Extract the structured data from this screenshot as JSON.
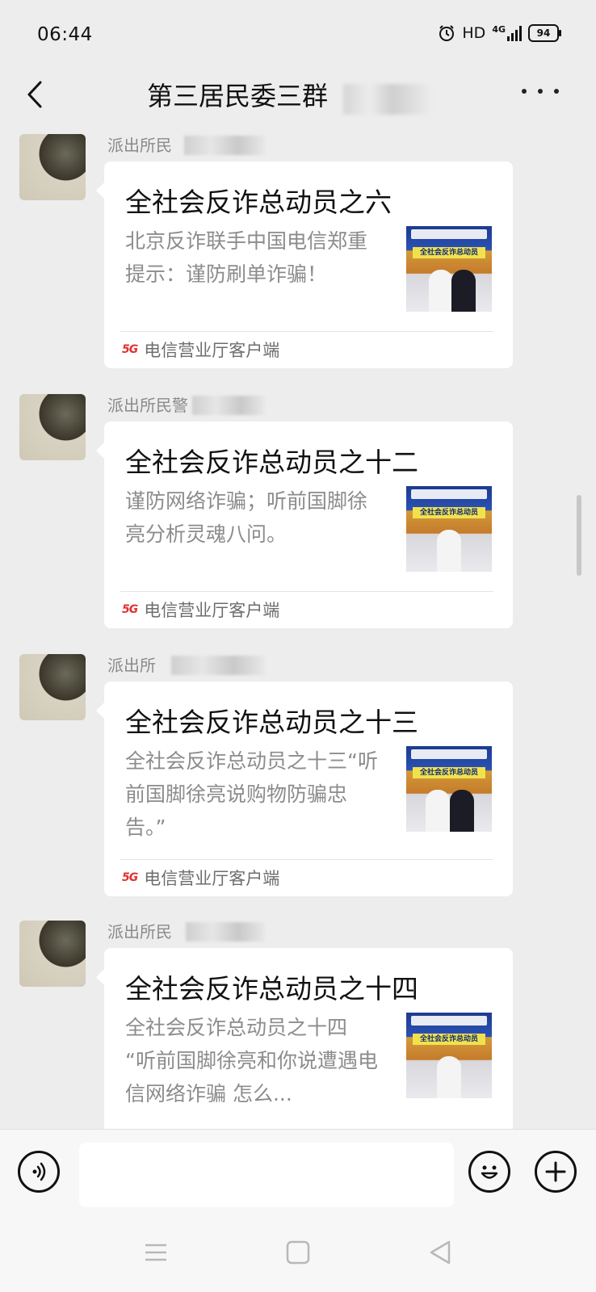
{
  "status_bar": {
    "time": "06:44",
    "hd": "HD",
    "network": "4G",
    "battery": "94"
  },
  "header": {
    "title": "第三居民委三群"
  },
  "messages": [
    {
      "sender": "派出所民",
      "title": "全社会反诈总动员之六",
      "description": "北京反诈联手中国电信郑重提示：谨防刷单诈骗！",
      "source": "电信营业厅客户端"
    },
    {
      "sender": "派出所民警",
      "title": "全社会反诈总动员之十二",
      "description": "谨防网络诈骗；听前国脚徐亮分析灵魂八问。",
      "source": "电信营业厅客户端"
    },
    {
      "sender": "派出所",
      "title": "全社会反诈总动员之十三",
      "description": "全社会反诈总动员之十三“听前国脚徐亮说购物防骗忠告。”",
      "source": "电信营业厅客户端"
    },
    {
      "sender": "派出所民",
      "title": "全社会反诈总动员之十四",
      "description": "全社会反诈总动员之十四 “听前国脚徐亮和你说遭遇电信网络诈骗 怎么...",
      "source": "电信营业厅客户端"
    }
  ],
  "thumbnail_banner": "全社会反诈总动员",
  "source_badge": "5G",
  "input": {
    "value": ""
  },
  "colors": {
    "background": "#ededed",
    "card": "#ffffff",
    "secondary_text": "#8c8c8c",
    "thumb_blue": "#2a52b5"
  }
}
